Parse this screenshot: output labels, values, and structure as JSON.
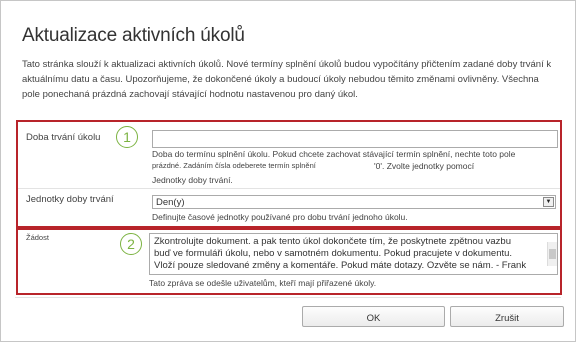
{
  "dialog": {
    "title": "Aktualizace aktivních úkolů",
    "intro": "Tato stránka slouží k aktualizaci aktivních úkolů. Nové termíny splnění úkolů budou vypočítány přičtením zadané doby trvání k aktuálnímu datu a času. Upozorňujeme, že dokončené úkoly a budoucí úkoly nebudou těmito změnami ovlivněny. Všechna pole ponechaná prázdná zachovají stávající hodnotu nastavenou pro daný úkol."
  },
  "fields": {
    "duration": {
      "label": "Doba trvání úkolu",
      "marker": "1",
      "value": "",
      "help_line1": "Doba do termínu splnění úkolu. Pokud chcete zachovat stávající termín splnění, nechte toto pole",
      "help_line2_a": "prázdné. Zadáním čísla odeberete termín splnění",
      "help_line2_b": "'0'. Zvolte jednotky pomocí",
      "help_line3": "Jednotky doby trvání."
    },
    "units": {
      "label": "Jednotky doby trvání",
      "selected": "Den(y)",
      "help": "Definujte časové jednotky používané pro dobu trvání jednoho úkolu."
    },
    "request": {
      "label": "Žádost",
      "marker": "2",
      "line1": "Zkontrolujte dokument. a pak tento úkol dokončete tím, že poskytnete zpětnou vazbu",
      "line2": "buď ve formuláři úkolu, nebo v samotném dokumentu. Pokud pracujete v dokumentu.",
      "line3": "Vloží pouze sledované změny a komentáře. Pokud máte dotazy. Ozvěte se nám. - Frank",
      "help": "Tato zpráva se odešle uživatelům, kteří mají přiřazené úkoly."
    }
  },
  "buttons": {
    "ok": "OK",
    "cancel": "Zrušit"
  },
  "colors": {
    "highlight_border": "#b8242a",
    "marker": "#7cb342"
  },
  "icons": {
    "dropdown": "chevron-down-icon"
  }
}
